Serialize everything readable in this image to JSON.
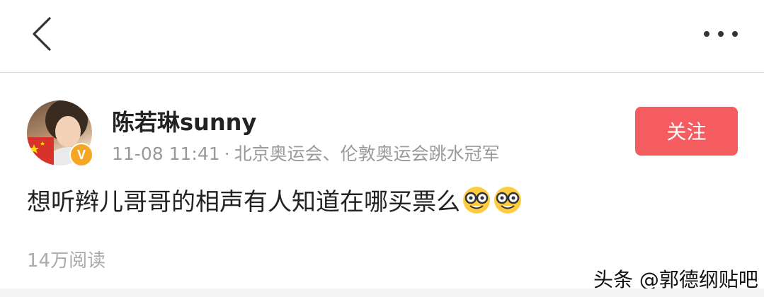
{
  "header": {
    "back_icon": "chevron-left-icon",
    "more_icon": "more-horizontal-icon"
  },
  "post": {
    "author": "陈若琳sunny",
    "verified_badge": "V",
    "time": "11-08 11:41",
    "separator": "·",
    "bio": "北京奥运会、伦敦奥运会跳水冠军",
    "follow_label": "关注",
    "content": "想听辫儿哥哥的相声有人知道在哪买票么",
    "emojis": [
      "nerd-face-icon",
      "nerd-face-icon"
    ],
    "reads": "14万阅读"
  },
  "watermark": "头条 @郭德纲贴吧",
  "colors": {
    "follow_button": "#f45c5f",
    "meta_text": "#999999",
    "verified_badge": "#f5a623"
  }
}
